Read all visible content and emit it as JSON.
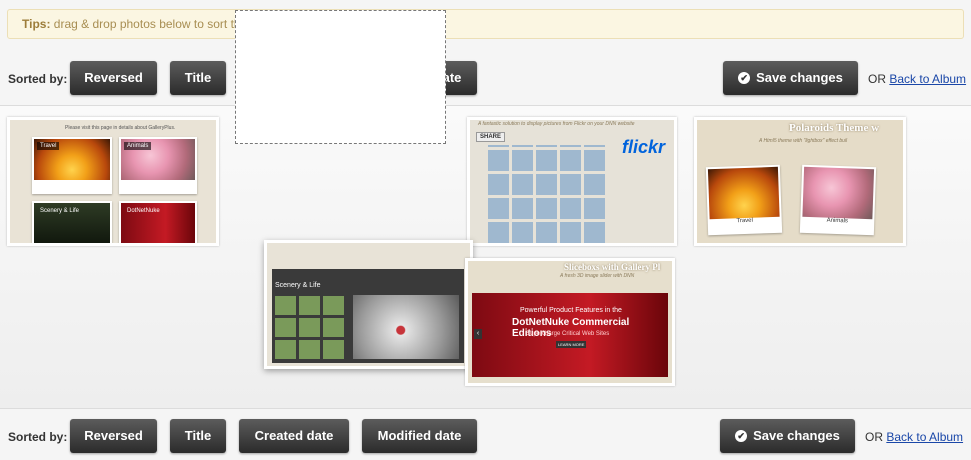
{
  "tips": {
    "label": "Tips:",
    "text": "drag & drop photos below to sort their orders."
  },
  "sort_bar": {
    "label": "Sorted by:",
    "buttons": [
      "Reversed",
      "Title",
      "Created date",
      "Modified date"
    ],
    "save_label": "Save changes",
    "or_text": "OR",
    "back_link": "Back to Album"
  },
  "thumbnails": [
    {
      "captions": [
        "Travel",
        "Animals",
        "Scenery & Life",
        "DotNetNuke"
      ],
      "header": "Please visit this page in details about GalleryPlus."
    },
    {
      "header": "A fantastic solution to display pictures from Flickr on your DNN website",
      "share": "SHARE",
      "brand": "flickr"
    },
    {
      "title": "Polaroids Theme w",
      "subtitle": "A Html5 theme with \"lightbox\" effect buil",
      "captions": [
        "Travel",
        "Animals"
      ]
    },
    {
      "title": "Scenery & Life"
    },
    {
      "title": "Sliceboxs with Gallery Pl",
      "subtitle": "A fresh 3D image slider with DNN",
      "line1": "Powerful Product Features in the",
      "line2": "DotNetNuke Commercial Editions",
      "line3": "Supercharge Critical Web Sites",
      "cta": "LEARN MORE"
    }
  ]
}
